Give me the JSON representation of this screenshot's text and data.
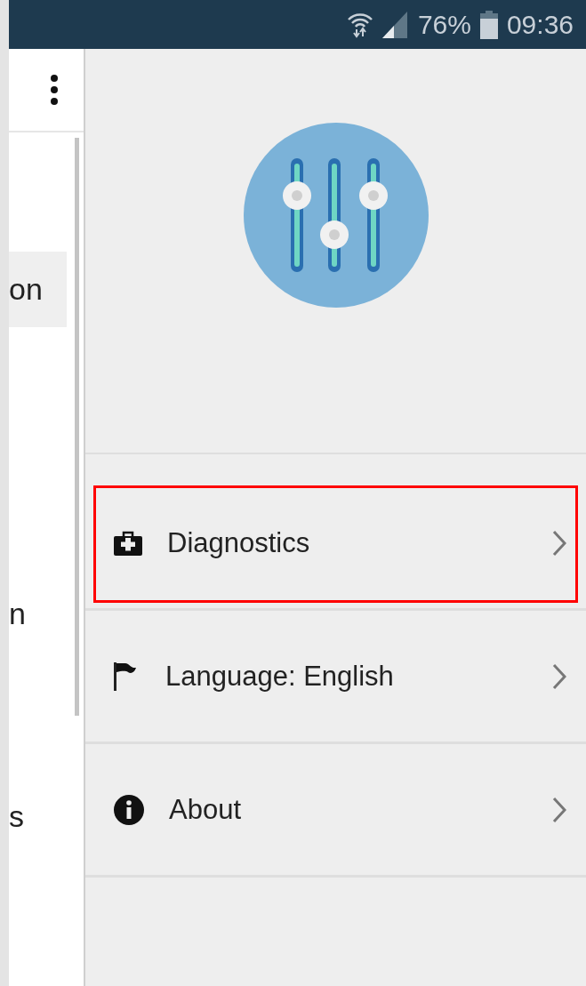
{
  "status_bar": {
    "battery": "76%",
    "time": "09:36"
  },
  "left_panel": {
    "items": [
      {
        "label": "on",
        "selected": true
      },
      {
        "label": "n",
        "selected": false
      },
      {
        "label": "s",
        "selected": false
      }
    ]
  },
  "drawer": {
    "items": [
      {
        "kind": "diagnostics",
        "label": "Diagnostics",
        "selected": true
      },
      {
        "kind": "language",
        "label": "Language: English",
        "selected": false
      },
      {
        "kind": "about",
        "label": "About",
        "selected": false
      }
    ]
  }
}
